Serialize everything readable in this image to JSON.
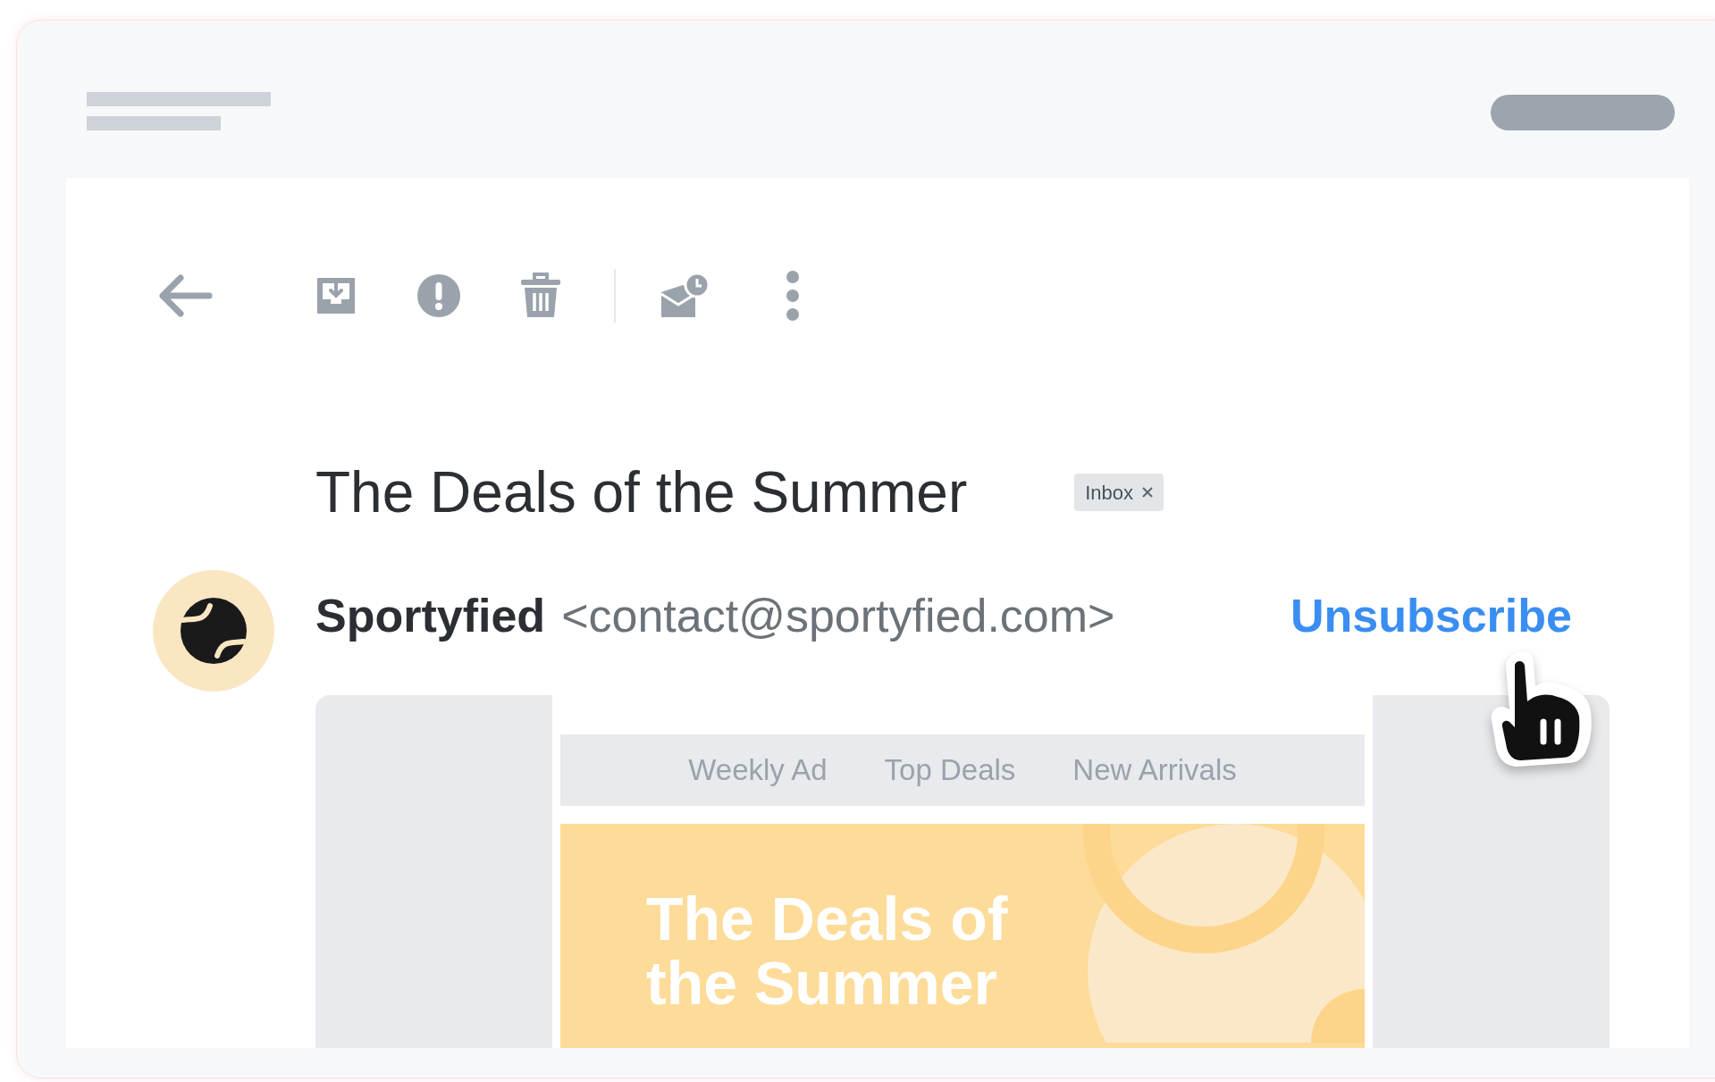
{
  "message": {
    "subject": "The Deals of the Summer",
    "label": {
      "text": "Inbox",
      "removable": true
    }
  },
  "sender": {
    "name": "Sportyfied",
    "email": "<contact@sportyfied.com>",
    "unsubscribe": "Unsubscribe"
  },
  "email_preview": {
    "nav": [
      "Weekly Ad",
      "Top Deals",
      "New Arrivals"
    ],
    "banner_heading_lines": [
      "The Deals of",
      "the Summer"
    ]
  }
}
